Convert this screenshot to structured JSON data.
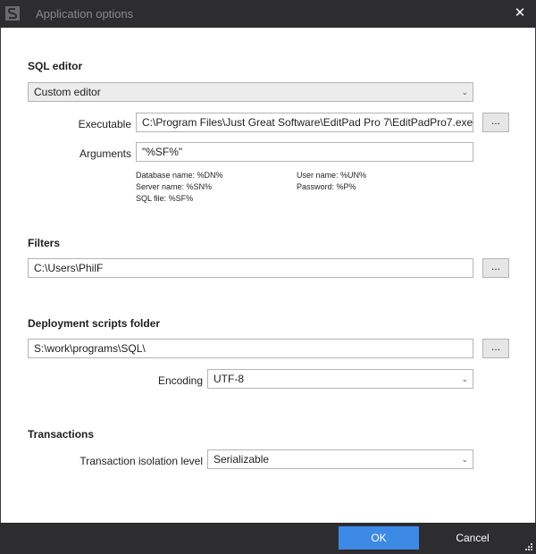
{
  "window": {
    "title": "Application options",
    "close_glyph": "✕"
  },
  "sql_editor": {
    "heading": "SQL editor",
    "mode": "Custom editor",
    "executable_label": "Executable",
    "executable_value": "C:\\Program Files\\Just Great Software\\EditPad Pro 7\\EditPadPro7.exe",
    "arguments_label": "Arguments",
    "arguments_value": "\"%SF%\"",
    "browse_label": "...",
    "hints": {
      "database": "Database name: %DN%",
      "server": "Server name: %SN%",
      "sqlfile": "SQL file: %SF%",
      "user": "User name: %UN%",
      "password": "Password: %P%"
    }
  },
  "filters": {
    "heading": "Filters",
    "path": "C:\\Users\\PhilF",
    "browse_label": "..."
  },
  "deployment": {
    "heading": "Deployment scripts folder",
    "path": "S:\\work\\programs\\SQL\\",
    "browse_label": "...",
    "encoding_label": "Encoding",
    "encoding_value": "UTF-8"
  },
  "transactions": {
    "heading": "Transactions",
    "isolation_label": "Transaction isolation level",
    "isolation_value": "Serializable"
  },
  "footer": {
    "ok_label": "OK",
    "cancel_label": "Cancel"
  },
  "icons": {
    "app": "app-logo-icon",
    "close": "close-icon",
    "dropdown": "chevron-down-icon",
    "resize": "resize-grip-icon"
  },
  "colors": {
    "titlebar": "#2d2d30",
    "accent": "#3d89e6",
    "border": "#b4b4b4"
  }
}
